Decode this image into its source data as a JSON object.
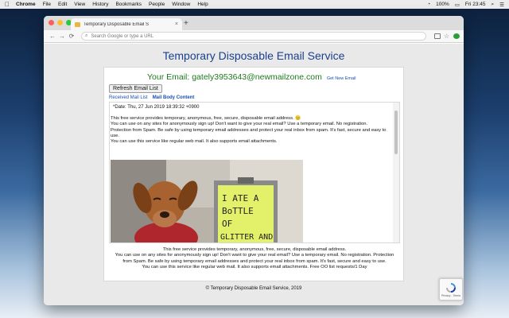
{
  "menubar": {
    "apple_icon": "apple-icon",
    "items": [
      "Chrome",
      "File",
      "Edit",
      "View",
      "History",
      "Bookmarks",
      "People",
      "Window",
      "Help"
    ],
    "status": {
      "battery": "100%",
      "date_time": "Fri 23:45"
    }
  },
  "browser": {
    "tab_title": "Temporary Disposable Email S",
    "tab_close": "×",
    "new_tab": "+",
    "omnibox_placeholder": "Search Google or type a URL",
    "back": "←",
    "forward": "→",
    "reload": "⟳"
  },
  "page": {
    "site_title": "Temporary Disposable Email Service",
    "email_label": "Your Email: gately3953643@newmailzone.com",
    "get_new_email": "Get New Email",
    "refresh_button": "Refresh Email List",
    "tabs": {
      "received": "Received Mail List",
      "body": "Mail Body Content"
    },
    "mail": {
      "date": "*Date: Thu, 27 Jun 2019 18:39:32 +0900",
      "lines": [
        "This free service provides temporary, anonymous, free, secure, disposable email address. 😊",
        "You can use on any sites for anonymously sign up! Don't want to give your real email? Use a temporary email. No registration.",
        "Protection from Spam. Be safe by using temporary email addresses and protect your real inbox from spam. It's fast, secure and easy to use.",
        "You can use this service like regular web mail. It also supports email attachments."
      ],
      "photo_sign_text": [
        "I ATE A",
        "BoTTLE",
        "OF",
        "GLITTER AND"
      ]
    },
    "footer_text": [
      "This free service provides temporary, anonymous, free, secure, disposable email address.",
      "You can use on any sites for anonymously sign up! Don't want to give your real email? Use a temporary email. No registration. Protection from Spam. Be safe by using temporary email addresses and protect your real inbox from spam. It's fast, secure and easy to use.",
      "You can use this service like regular web mail. It also supports email attachments. Free OO list requests/1 Day"
    ],
    "copyright": "© Temporary Disposable Email Service, 2019",
    "recaptcha_text": "Privacy - Terms"
  },
  "colors": {
    "title_blue": "#1a3f8c",
    "email_green": "#1e7a1e",
    "link_blue": "#1a4fb0"
  }
}
